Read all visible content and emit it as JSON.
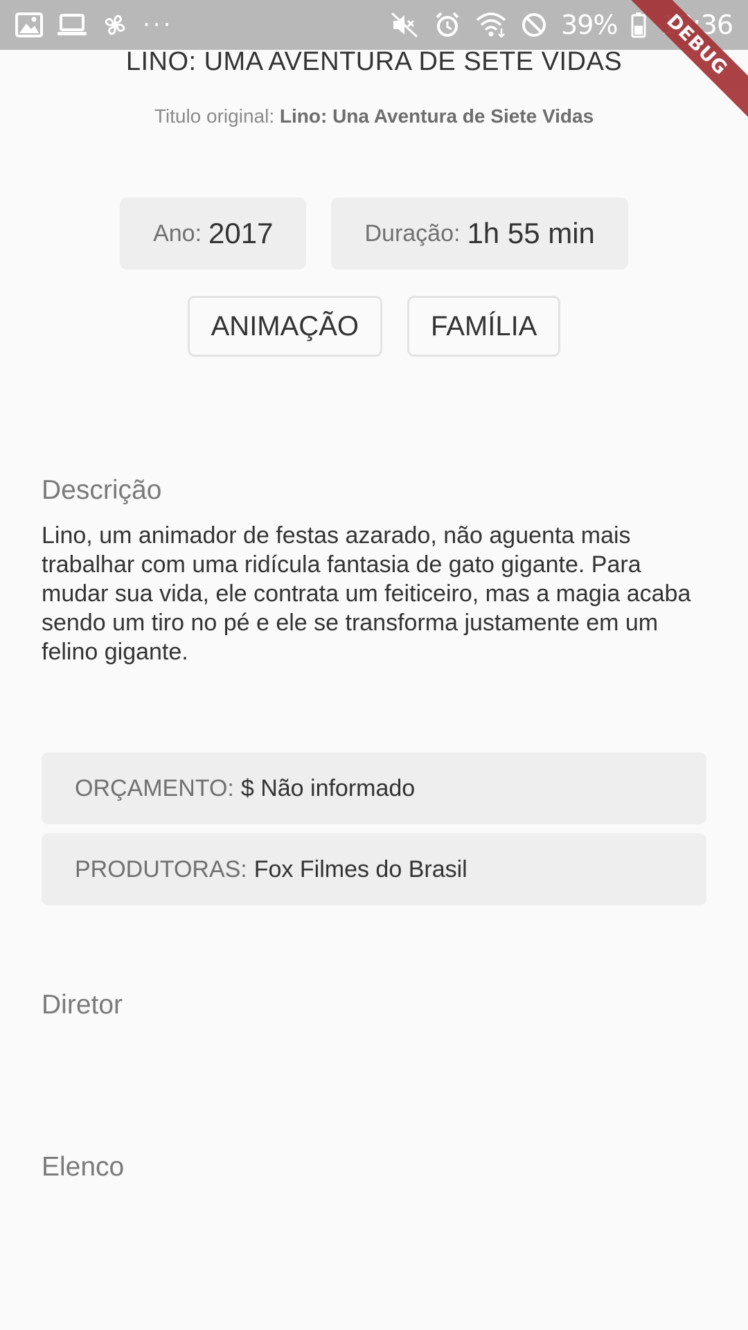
{
  "status_bar": {
    "left_icons": [
      "image-icon",
      "laptop-icon",
      "pinwheel-icon",
      "more-dots-icon"
    ],
    "dots": "···",
    "battery_percent": "39%",
    "time": "18:36"
  },
  "debug_banner": {
    "label": "DEBUG"
  },
  "movie": {
    "title": "LINO: UMA AVENTURA DE SETE VIDAS",
    "original_title_label": "Titulo original:",
    "original_title_value": "Lino: Una Aventura de Siete Vidas"
  },
  "info": {
    "year_label": "Ano:",
    "year_value": "2017",
    "duration_label": "Duração:",
    "duration_value": "1h 55 min"
  },
  "genres": [
    "ANIMAÇÃO",
    "FAMÍLIA"
  ],
  "description": {
    "heading": "Descrição",
    "text": "Lino, um animador de festas azarado, não aguenta mais trabalhar com uma ridícula fantasia de gato gigante. Para mudar sua vida, ele contrata um feiticeiro, mas a magia acaba sendo um tiro no pé e ele se transforma justamente em um felino gigante."
  },
  "details": {
    "budget_label": "ORÇAMENTO:",
    "budget_value": "$ Não informado",
    "producers_label": "PRODUTORAS:",
    "producers_value": "Fox Filmes do Brasil"
  },
  "sections": {
    "director_heading": "Diretor",
    "cast_heading": "Elenco"
  },
  "colors": {
    "background": "#fafafa",
    "status_bar": "#b8b8b8",
    "chip_background": "#eeeeee",
    "debug_ribbon": "#a33236",
    "text_primary": "#333333",
    "text_secondary": "#7a7a7a"
  }
}
